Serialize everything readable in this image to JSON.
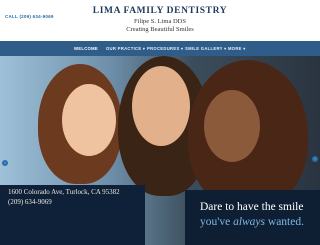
{
  "header": {
    "call_text": "CALL (209) 634-9069",
    "title": "LIMA FAMILY DENTISTRY",
    "doctor": "Filipe S. Lima DDS",
    "tagline": "Creating Beautiful Smiles"
  },
  "nav": {
    "items": [
      "WELCOME",
      "OUR PRACTICE ▾",
      "PROCEDURES ▾",
      "SMILE GALLERY ▾",
      "MORE ▾"
    ],
    "active_index": 0
  },
  "hero": {
    "address": "1600 Colorado Ave, Turlock, CA 95382",
    "phone": "(209) 634-9069",
    "cta_line1": "Dare to have the smile",
    "cta_line2_prefix": "you've ",
    "cta_line2_emph": "always",
    "cta_line2_suffix": " wanted."
  },
  "colors": {
    "nav_bg": "#2f5d8a",
    "brand": "#1f3b5b",
    "cta_accent": "#7fb6e6"
  },
  "icons": [
    "chevron-left-icon",
    "chevron-right-icon"
  ]
}
